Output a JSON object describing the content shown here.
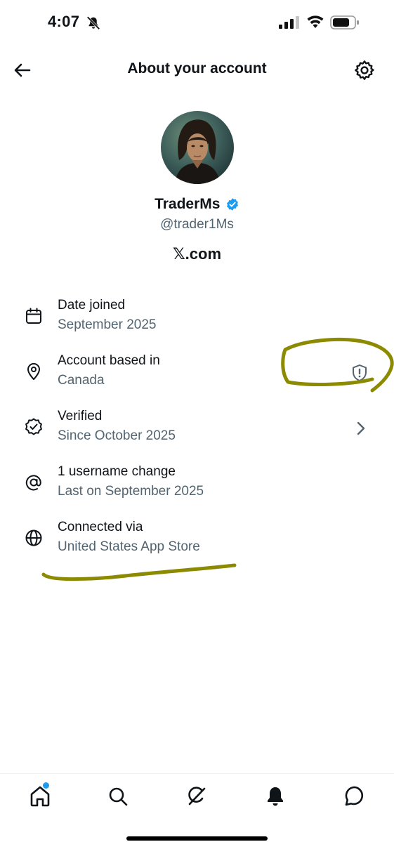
{
  "status_bar": {
    "time": "4:07",
    "icons": [
      "bell-slash-icon",
      "cellular-signal-icon",
      "wifi-icon",
      "battery-icon"
    ]
  },
  "header": {
    "title": "About your account",
    "back_icon": "arrow-left-icon",
    "settings_icon": "gear-icon"
  },
  "profile": {
    "name": "TraderMs",
    "handle": "@trader1Ms",
    "domain": "𝕏.com",
    "verified": true,
    "verified_color": "#1d9bf0"
  },
  "info_rows": [
    {
      "icon": "calendar-icon",
      "title": "Date joined",
      "subtitle": "September 2025"
    },
    {
      "icon": "location-pin-icon",
      "title": "Account based in",
      "subtitle": "Canada",
      "trailing_icon": "shield-alert-icon"
    },
    {
      "icon": "verified-badge-outline-icon",
      "title": "Verified",
      "subtitle": "Since October 2025",
      "trailing_icon": "chevron-right-icon"
    },
    {
      "icon": "at-sign-icon",
      "title": "1 username change",
      "subtitle": "Last on September 2025"
    },
    {
      "icon": "globe-icon",
      "title": "Connected via",
      "subtitle": "United States App Store"
    }
  ],
  "annotation": {
    "color": "#8c8a00",
    "marks": [
      "circle-around-shield",
      "underline-connected-via"
    ]
  },
  "tab_bar": {
    "tabs": [
      "home-icon",
      "search-icon",
      "grok-icon",
      "notifications-bell-icon",
      "messages-icon"
    ],
    "active": "home-icon",
    "home_has_dot": true,
    "dot_color": "#1d9bf0"
  }
}
